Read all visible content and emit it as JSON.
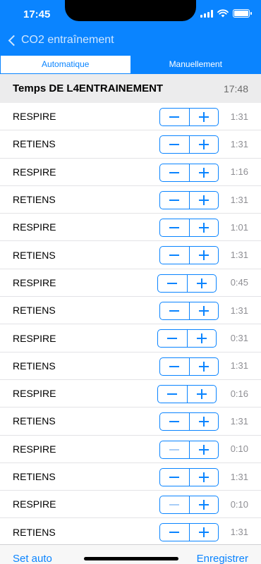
{
  "status_bar": {
    "time": "17:45"
  },
  "nav": {
    "back_label": "CO2 entraînement"
  },
  "segments": [
    {
      "label": "Automatique",
      "selected": true
    },
    {
      "label": "Manuellement",
      "selected": false
    }
  ],
  "header": {
    "title": "Temps DE L4ENTRAINEMENT",
    "total_time": "17:48"
  },
  "rows": [
    {
      "label": "RESPIRE",
      "time": "1:31",
      "minus_enabled": true
    },
    {
      "label": "RETIENS",
      "time": "1:31",
      "minus_enabled": true
    },
    {
      "label": "RESPIRE",
      "time": "1:16",
      "minus_enabled": true
    },
    {
      "label": "RETIENS",
      "time": "1:31",
      "minus_enabled": true
    },
    {
      "label": "RESPIRE",
      "time": "1:01",
      "minus_enabled": true
    },
    {
      "label": "RETIENS",
      "time": "1:31",
      "minus_enabled": true
    },
    {
      "label": "RESPIRE",
      "time": "0:45",
      "minus_enabled": true
    },
    {
      "label": "RETIENS",
      "time": "1:31",
      "minus_enabled": true
    },
    {
      "label": "RESPIRE",
      "time": "0:31",
      "minus_enabled": true
    },
    {
      "label": "RETIENS",
      "time": "1:31",
      "minus_enabled": true
    },
    {
      "label": "RESPIRE",
      "time": "0:16",
      "minus_enabled": true
    },
    {
      "label": "RETIENS",
      "time": "1:31",
      "minus_enabled": true
    },
    {
      "label": "RESPIRE",
      "time": "0:10",
      "minus_enabled": false
    },
    {
      "label": "RETIENS",
      "time": "1:31",
      "minus_enabled": true
    },
    {
      "label": "RESPIRE",
      "time": "0:10",
      "minus_enabled": false
    },
    {
      "label": "RETIENS",
      "time": "1:31",
      "minus_enabled": true
    }
  ],
  "footer": {
    "left_label": "Set auto",
    "right_label": "Enregistrer"
  },
  "colors": {
    "accent": "#0a84ff",
    "header_bg": "#ececed",
    "secondary_text": "#8e8e93"
  }
}
